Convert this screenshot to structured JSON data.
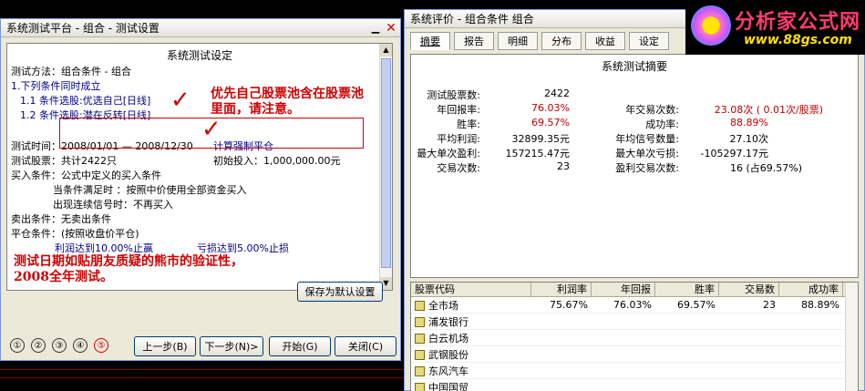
{
  "left_window": {
    "title": "系统测试平台 - 组合 - 测试设置",
    "heading": "系统测试设定",
    "method": "测试方法：组合条件 - 组合",
    "line1": "1.下列条件同时成立",
    "line1_1": "1.1 条件选股:优选自己[日线]",
    "line1_2": "1.2 条件选股:潜在反转[日线]",
    "test_time": "测试时间：2008/01/01 — 2008/12/30",
    "test_time_extra": "计算强制平仓",
    "test_stock": "测试股票：共计2422只",
    "initial_invest": "初始投入：1,000,000.00元",
    "buy_cond": "买入条件：公式中定义的买入条件",
    "when_met": "当条件满足时 ：按照中价使用全部资金买入",
    "consecutive": "出现连续信号时：不再买入",
    "sell_cond": "卖出条件：无卖出条件",
    "close_cond": "平仓条件：(按照收盘价平仓)",
    "profit_stop": "利润达到10.00%止赢",
    "loss_stop": "亏损达到5.00%止损",
    "note_top": "优先自己股票池含在股票池里面，请注意。",
    "note_bottom": "测试日期如贴朋友质疑的熊市的验证性，2008全年测试。",
    "save_default": "保存为默认设置",
    "steps": [
      "①",
      "②",
      "③",
      "④",
      "⑤"
    ],
    "prev": "上一步(B)",
    "next": "下一步(N)>",
    "start": "开始(G)",
    "close": "关闭(C)"
  },
  "right_window": {
    "title": "系统评价 - 组合条件 组合",
    "tabs": [
      "摘要",
      "报告",
      "明细",
      "分布",
      "收益",
      "设定"
    ],
    "summary_heading": "系统测试摘要",
    "rows": [
      {
        "l": "测试股票数:",
        "lv": "2422",
        "r": "",
        "rv": ""
      },
      {
        "l": "年回报率:",
        "lv": "76.03%",
        "r": "年交易次数:",
        "rv": "23.08次 ( 0.01次/股票)"
      },
      {
        "l": "胜率:",
        "lv": "69.57%",
        "r": "成功率:",
        "rv": "88.89%"
      },
      {
        "l": "平均利润:",
        "lv": "32899.35元",
        "r": "年均信号数量:",
        "rv": "27.10次"
      },
      {
        "l": "最大单次盈利:",
        "lv": "157215.47元",
        "r": "最大单次亏损:",
        "rv": "-105297.17元"
      },
      {
        "l": "交易次数:",
        "lv": "23",
        "r": "盈利交易次数:",
        "rv": "16 (占69.57%)"
      }
    ],
    "table_headers": [
      "股票代码",
      "利润率",
      "年回报",
      "胜率",
      "交易数",
      "成功率"
    ],
    "table_rows": [
      {
        "name": "全市场",
        "profit": "75.67%",
        "annual": "76.03%",
        "win": "69.57%",
        "trades": "23",
        "success": "88.89%"
      },
      {
        "name": "浦发银行",
        "profit": "",
        "annual": "",
        "win": "",
        "trades": "",
        "success": ""
      },
      {
        "name": "白云机场",
        "profit": "",
        "annual": "",
        "win": "",
        "trades": "",
        "success": ""
      },
      {
        "name": "武钢股份",
        "profit": "",
        "annual": "",
        "win": "",
        "trades": "",
        "success": ""
      },
      {
        "name": "东风汽车",
        "profit": "",
        "annual": "",
        "win": "",
        "trades": "",
        "success": ""
      },
      {
        "name": "中国国贸",
        "profit": "",
        "annual": "",
        "win": "",
        "trades": "",
        "success": ""
      }
    ]
  },
  "logo": {
    "main": "分析家公式网",
    "url": "www.88gs.com"
  }
}
